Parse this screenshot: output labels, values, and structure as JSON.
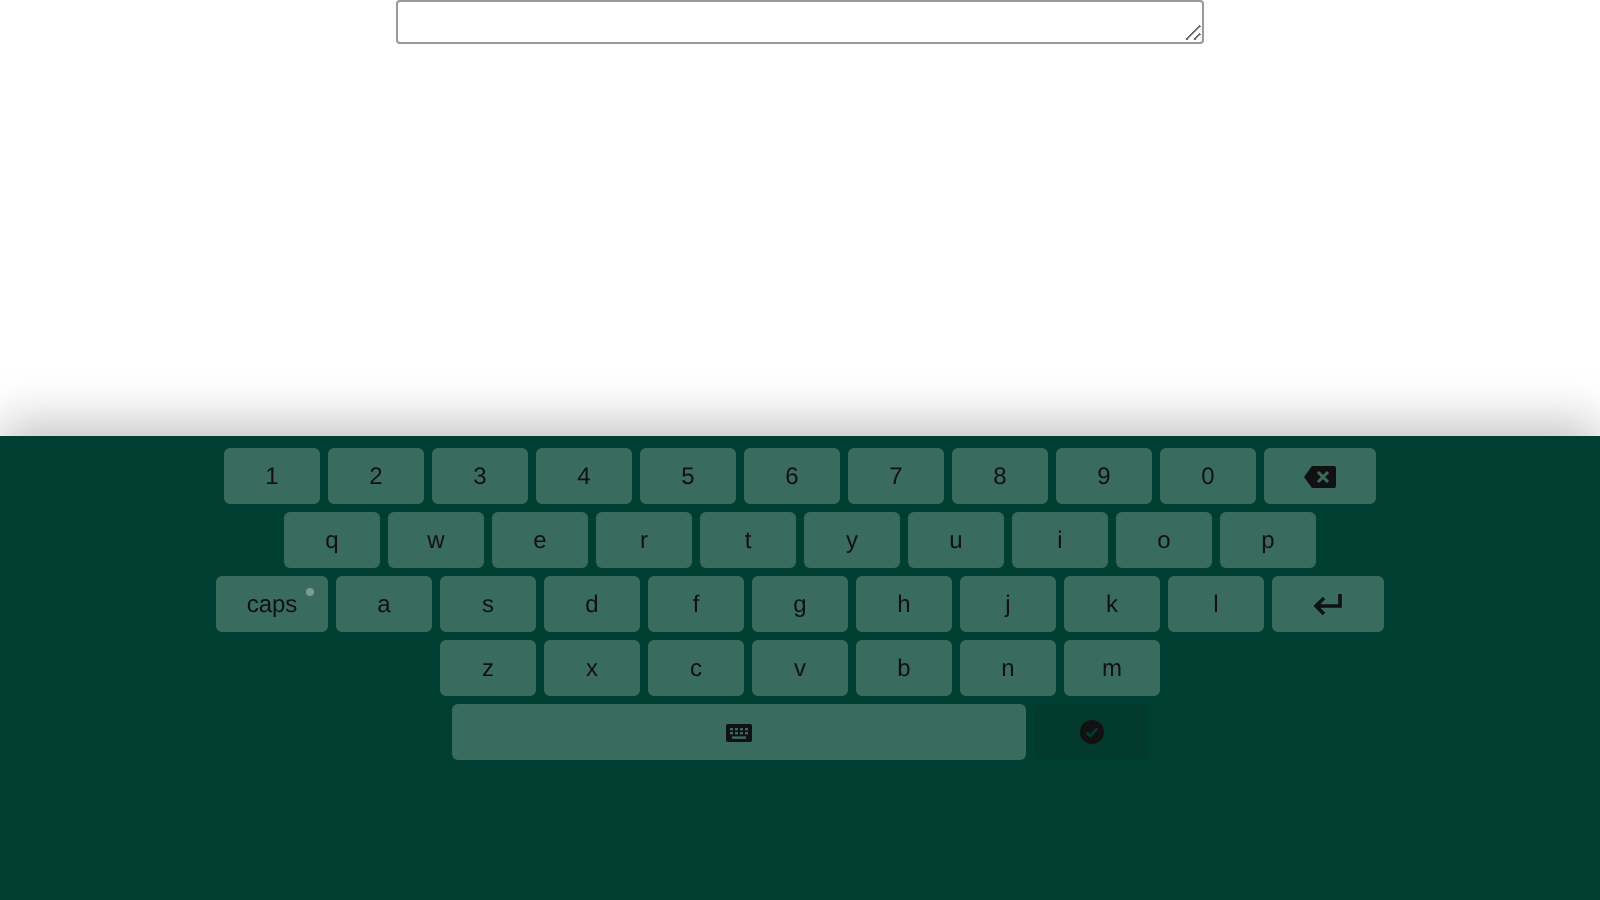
{
  "keyboard": {
    "rows": [
      [
        {
          "kind": "char",
          "label": "1"
        },
        {
          "kind": "char",
          "label": "2"
        },
        {
          "kind": "char",
          "label": "3"
        },
        {
          "kind": "char",
          "label": "4"
        },
        {
          "kind": "char",
          "label": "5"
        },
        {
          "kind": "char",
          "label": "6"
        },
        {
          "kind": "char",
          "label": "7"
        },
        {
          "kind": "char",
          "label": "8"
        },
        {
          "kind": "char",
          "label": "9"
        },
        {
          "kind": "char",
          "label": "0"
        },
        {
          "kind": "backspace"
        }
      ],
      [
        {
          "kind": "char",
          "label": "q"
        },
        {
          "kind": "char",
          "label": "w"
        },
        {
          "kind": "char",
          "label": "e"
        },
        {
          "kind": "char",
          "label": "r"
        },
        {
          "kind": "char",
          "label": "t"
        },
        {
          "kind": "char",
          "label": "y"
        },
        {
          "kind": "char",
          "label": "u"
        },
        {
          "kind": "char",
          "label": "i"
        },
        {
          "kind": "char",
          "label": "o"
        },
        {
          "kind": "char",
          "label": "p"
        }
      ],
      [
        {
          "kind": "caps",
          "label": "caps",
          "on": false
        },
        {
          "kind": "char",
          "label": "a"
        },
        {
          "kind": "char",
          "label": "s"
        },
        {
          "kind": "char",
          "label": "d"
        },
        {
          "kind": "char",
          "label": "f"
        },
        {
          "kind": "char",
          "label": "g"
        },
        {
          "kind": "char",
          "label": "h"
        },
        {
          "kind": "char",
          "label": "j"
        },
        {
          "kind": "char",
          "label": "k"
        },
        {
          "kind": "char",
          "label": "l"
        },
        {
          "kind": "enter"
        }
      ],
      [
        {
          "kind": "char",
          "label": "z"
        },
        {
          "kind": "char",
          "label": "x"
        },
        {
          "kind": "char",
          "label": "c"
        },
        {
          "kind": "char",
          "label": "v"
        },
        {
          "kind": "char",
          "label": "b"
        },
        {
          "kind": "char",
          "label": "n"
        },
        {
          "kind": "char",
          "label": "m"
        }
      ],
      [
        {
          "kind": "space"
        },
        {
          "kind": "done"
        }
      ]
    ]
  }
}
